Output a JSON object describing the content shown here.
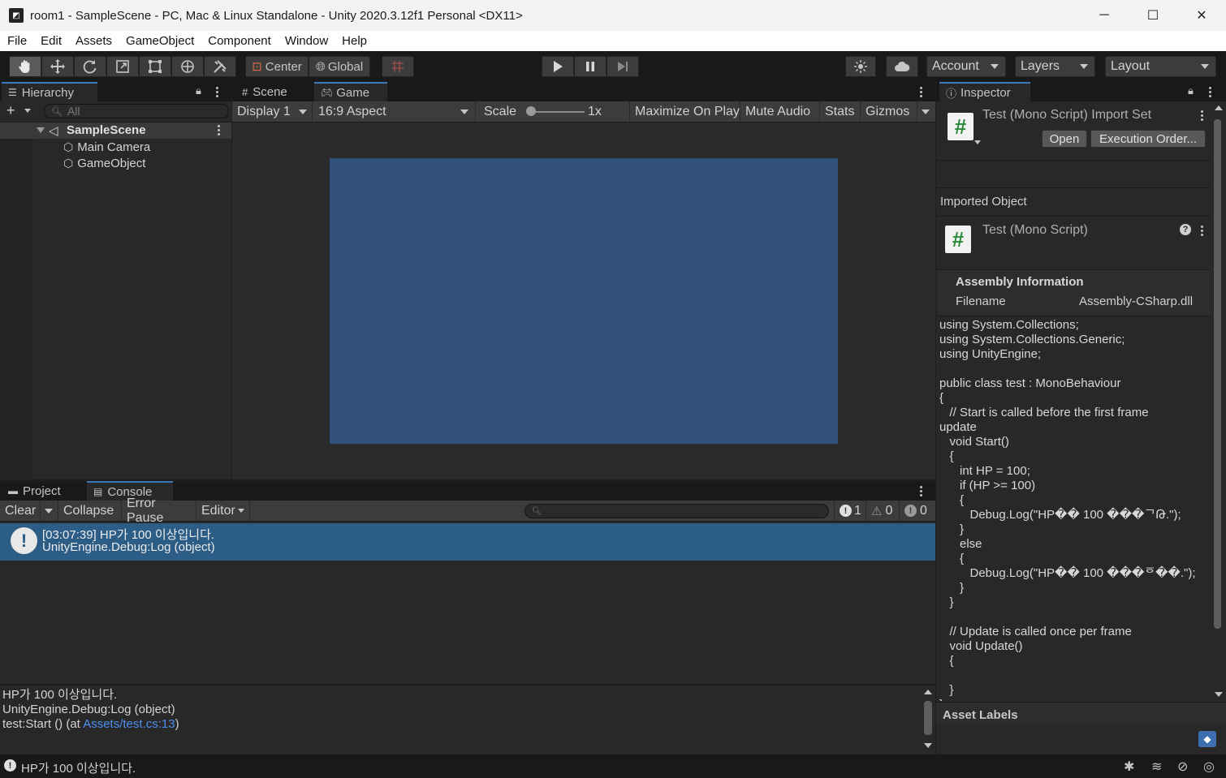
{
  "window": {
    "title": "room1 - SampleScene - PC, Mac & Linux Standalone - Unity 2020.3.12f1 Personal <DX11>",
    "minimize": "─",
    "maximize": "☐",
    "close": "✕"
  },
  "menu": [
    "File",
    "Edit",
    "Assets",
    "GameObject",
    "Component",
    "Window",
    "Help"
  ],
  "toolbar": {
    "pivot": "Center",
    "space": "Global",
    "account": "Account",
    "layers": "Layers",
    "layout": "Layout"
  },
  "hierarchy": {
    "tab": "Hierarchy",
    "search_placeholder": "All",
    "scene": "SampleScene",
    "objects": [
      "Main Camera",
      "GameObject"
    ]
  },
  "game": {
    "tabs": [
      "Scene",
      "Game"
    ],
    "display": "Display 1",
    "aspect": "16:9 Aspect",
    "scale_label": "Scale",
    "scale_value": "1x",
    "maximize": "Maximize On Play",
    "mute": "Mute Audio",
    "stats": "Stats",
    "gizmos": "Gizmos",
    "screen_color": "#31507c"
  },
  "inspector": {
    "tab": "Inspector",
    "import_title": "Test (Mono Script) Import Set",
    "open": "Open",
    "exec_order": "Execution Order...",
    "imported_object": "Imported Object",
    "script_title": "Test (Mono Script)",
    "assembly_header": "Assembly Information",
    "filename_label": "Filename",
    "filename_value": "Assembly-CSharp.dll",
    "code": "using System.Collections;\nusing System.Collections.Generic;\nusing UnityEngine;\n\npublic class test : MonoBehaviour\n{\n   // Start is called before the first frame\nupdate\n   void Start()\n   {\n      int HP = 100;\n      if (HP >= 100)\n      {\n         Debug.Log(\"HP�� 100 ���ᄀԹ.\");\n      }\n      else\n      {\n         Debug.Log(\"HP�� 100 ���ᅙ��.\");\n      }\n   }\n\n   // Update is called once per frame\n   void Update()\n   {\n\n   }\n}",
    "asset_labels": "Asset Labels"
  },
  "console": {
    "tabs": [
      "Project",
      "Console"
    ],
    "clear": "Clear",
    "collapse": "Collapse",
    "error_pause": "Error Pause",
    "editor": "Editor",
    "counts": {
      "info": "1",
      "warn": "0",
      "error": "0"
    },
    "entry_line1": "[03:07:39] HP가 100 이상입니다.",
    "entry_line2": "UnityEngine.Debug:Log (object)",
    "detail_line1": "HP가 100 이상입니다.",
    "detail_line2": "UnityEngine.Debug:Log (object)",
    "detail_line3_prefix": "test:Start () (at ",
    "detail_link": "Assets/test.cs:13",
    "detail_line3_suffix": ")"
  },
  "status": {
    "message": "HP가 100 이상입니다."
  }
}
